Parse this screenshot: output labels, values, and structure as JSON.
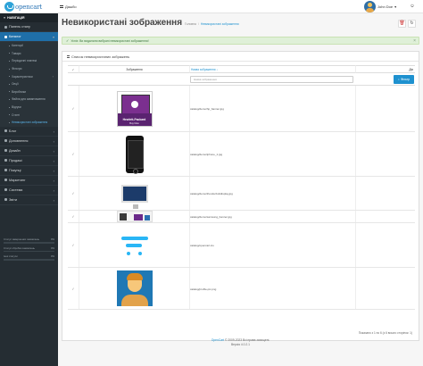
{
  "header": {
    "logo_text": "opencart",
    "menu_label": "Дашбо",
    "user_name": "John Doe",
    "user_chevron": "▾",
    "logout_icon": "power-icon"
  },
  "sidebar": {
    "title": "НАВІГАЦІЯ",
    "items": [
      {
        "label": "Панель стану",
        "icon": "dashboard-icon",
        "chevron": ""
      },
      {
        "label": "Каталог",
        "icon": "tag-icon",
        "chevron": "▾",
        "active": true
      }
    ],
    "catalog_sub": [
      {
        "label": "Категорії",
        "chevron": false
      },
      {
        "label": "Товари",
        "chevron": false
      },
      {
        "label": "Періодичні платежі",
        "chevron": false
      },
      {
        "label": "Фільтри",
        "chevron": false
      },
      {
        "label": "Характеристики",
        "chevron": true
      },
      {
        "label": "Опції",
        "chevron": false
      },
      {
        "label": "Виробники",
        "chevron": false
      },
      {
        "label": "Файли для завантаження",
        "chevron": false
      },
      {
        "label": "Відгуки",
        "chevron": false
      },
      {
        "label": "Статті",
        "chevron": false
      },
      {
        "label": "Невикористані зображення",
        "chevron": false,
        "current": true
      }
    ],
    "main_items": [
      {
        "label": "Блог",
        "icon": "blog-icon"
      },
      {
        "label": "Доповнення",
        "icon": "puzzle-icon"
      },
      {
        "label": "Дизайн",
        "icon": "desktop-icon"
      },
      {
        "label": "Продажі",
        "icon": "cart-icon"
      },
      {
        "label": "Покупці",
        "icon": "user-icon"
      },
      {
        "label": "Маркетинг",
        "icon": "share-icon"
      },
      {
        "label": "Система",
        "icon": "cog-icon"
      },
      {
        "label": "Звіти",
        "icon": "bar-chart-icon"
      }
    ],
    "stats": [
      {
        "label": "Статус завершених замовлень",
        "value": "0%"
      },
      {
        "label": "Статус обробки замовлень",
        "value": "0%"
      },
      {
        "label": "Інші статуси",
        "value": "0%"
      }
    ]
  },
  "page": {
    "title": "Невикористані зображення",
    "breadcrumb_home": "Головна",
    "breadcrumb_sep": "/",
    "breadcrumb_current": "Невикористані зображення",
    "delete_icon": "trash-icon",
    "refresh_icon": "refresh-icon"
  },
  "alert": {
    "icon": "check-circle-icon",
    "text": "Успіх: Ви видалили вибрані невикористані зображення!",
    "close": "×"
  },
  "panel": {
    "title": "Список невикористаних зображень",
    "col_select": "✓",
    "col_image": "Зображення",
    "col_name": "Назва зображення ↓",
    "col_action": "Дія",
    "filter_placeholder": "Назва зображення",
    "filter_button": "Фільтр"
  },
  "rows": [
    {
      "path": "catalog/demo/hp_banner.jpg",
      "thumb": "hp",
      "hp_brand": "Hewlett-Packard",
      "hp_sub": "Buy Now"
    },
    {
      "path": "catalog/demo/iphone_1.jpg",
      "thumb": "phone"
    },
    {
      "path": "catalog/demo/thunderboltdisplay.jpg",
      "thumb": "monitor"
    },
    {
      "path": "catalog/demo/samsung_banner.jpg",
      "thumb": "samsung"
    },
    {
      "path": "catalog/opencart.ico",
      "thumb": "cart"
    },
    {
      "path": "catalog/profile-pic.png",
      "thumb": "profile"
    }
  ],
  "pagination": "Показано з 1 по 6 (з 6 всього сторінок: 1)",
  "footer": {
    "line1_link": "OpenCart",
    "line1_text": "© 2009-2023 Всі права захищені.",
    "line2": "Версія 4.0.2.1"
  }
}
